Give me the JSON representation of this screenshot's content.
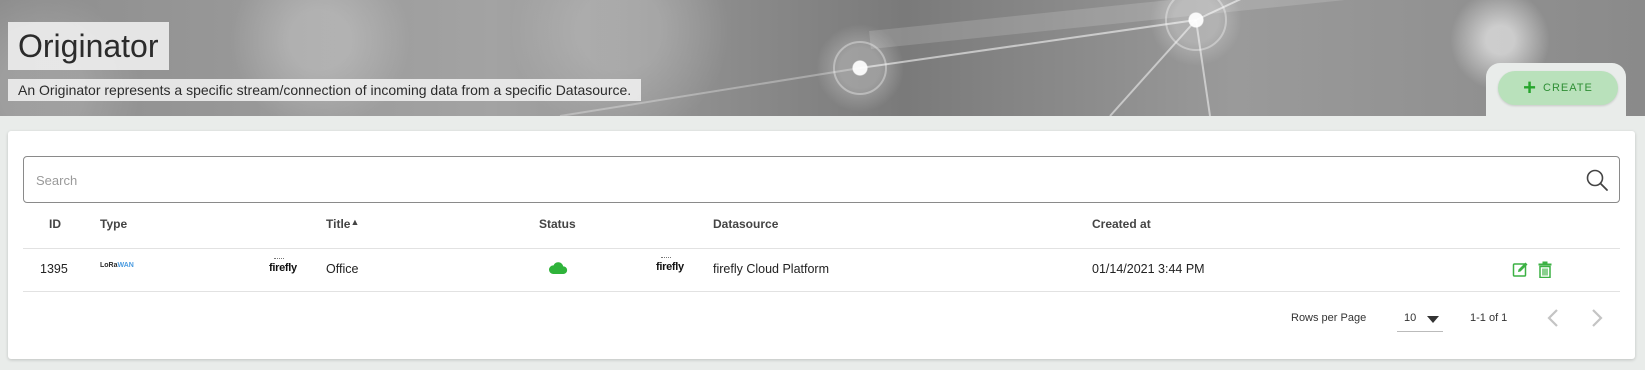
{
  "header": {
    "title": "Originator",
    "subtitle": "An Originator represents a specific stream/connection of incoming data from a specific Datasource.",
    "create_label": "CREATE"
  },
  "search": {
    "placeholder": "Search",
    "value": ""
  },
  "table": {
    "columns": [
      "ID",
      "Type",
      "Title",
      "Status",
      "Datasource",
      "Created at"
    ],
    "sorted_column": "Title",
    "sort_direction": "asc",
    "rows": [
      {
        "id": "1395",
        "type_logo_text": "LoRa",
        "type_logo_text_accent": "WAN",
        "type_brand": "firefly",
        "title": "Office",
        "status": "cloud-online",
        "datasource_brand": "firefly",
        "datasource": "firefly Cloud Platform",
        "created_at": "01/14/2021 3:44 PM"
      }
    ]
  },
  "pagination": {
    "rows_per_page_label": "Rows per Page",
    "rows_per_page": "10",
    "range": "1-1 of 1"
  },
  "colors": {
    "accent_green": "#26a52c",
    "create_bg": "#b9e1bb",
    "status_cloud": "#2fb33a"
  }
}
